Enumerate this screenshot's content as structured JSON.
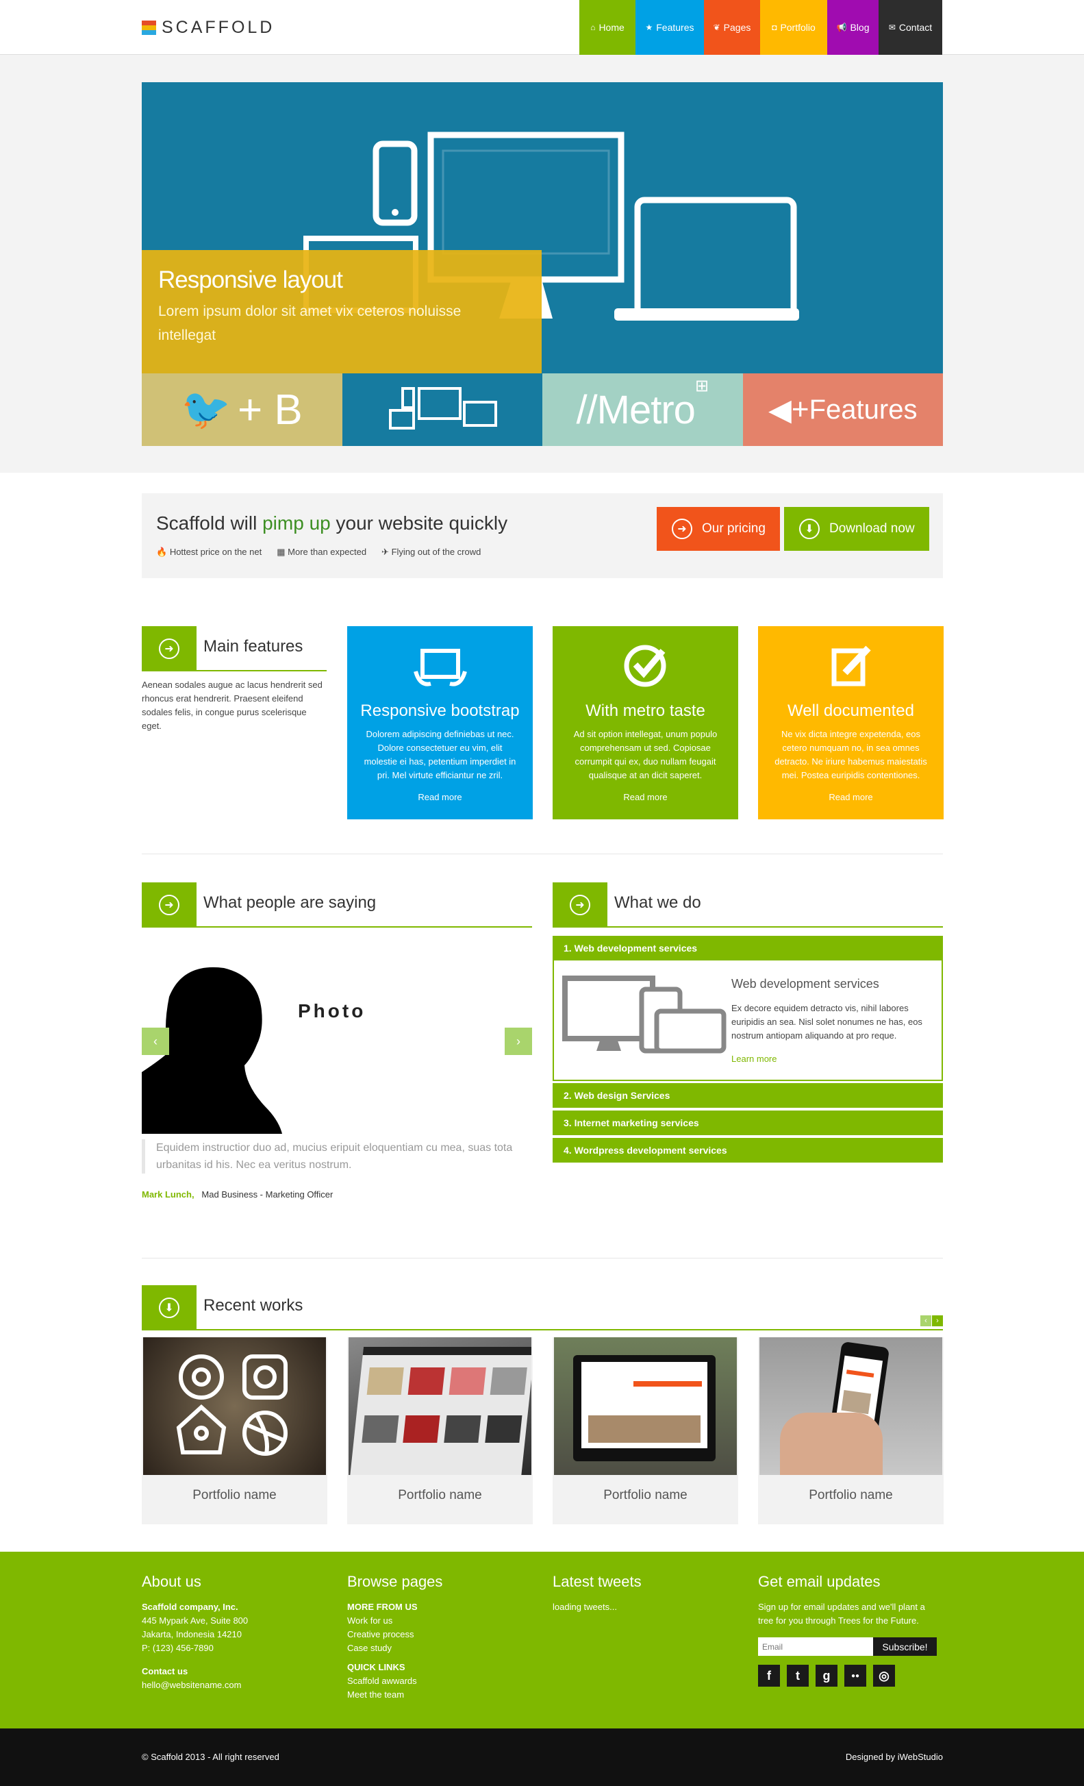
{
  "brand": {
    "name": "SCAFFOLD",
    "logo_colors": [
      "#e54d26",
      "#f2b705",
      "#29a8e0"
    ]
  },
  "nav": [
    {
      "label": "Home",
      "icon": "home-icon",
      "glyph": "⌂",
      "color": "#7fb800"
    },
    {
      "label": "Features",
      "icon": "star-icon",
      "glyph": "★",
      "color": "#00a1e5"
    },
    {
      "label": "Pages",
      "icon": "leaf-icon",
      "glyph": "❦",
      "color": "#f1541b"
    },
    {
      "label": "Portfolio",
      "icon": "camera-icon",
      "glyph": "◘",
      "color": "#ffb900"
    },
    {
      "label": "Blog",
      "icon": "megaphone-icon",
      "glyph": "📢",
      "color": "#a00cb0"
    },
    {
      "label": "Contact",
      "icon": "envelope-icon",
      "glyph": "✉",
      "color": "#2d2d2d"
    }
  ],
  "hero": {
    "title": "Responsive layout",
    "text": "Lorem ipsum dolor sit amet vix ceteros noluisse intellegat"
  },
  "tiles": [
    {
      "label": "+ B",
      "color": "#d0c176"
    },
    {
      "label": "",
      "color": "#167ba0"
    },
    {
      "label": "//Metro",
      "color": "#a3d1c4"
    },
    {
      "label": "Features",
      "color": "#e4826a"
    }
  ],
  "promo": {
    "title_pre": "Scaffold will ",
    "title_hl": "pimp up",
    "title_post": " your website quickly",
    "points": [
      "Hottest price on the net",
      "More than expected",
      "Flying out of the crowd"
    ],
    "pricing_label": "Our pricing",
    "download_label": "Download now"
  },
  "main_features": {
    "title": "Main features",
    "text": "Aenean sodales augue ac lacus hendrerit sed rhoncus erat hendrerit. Praesent eleifend sodales felis, in congue purus scelerisque eget."
  },
  "features": [
    {
      "title": "Responsive bootstrap",
      "text": "Dolorem adipiscing definiebas ut nec. Dolore consectetuer eu vim, elit molestie ei has, petentium imperdiet in pri. Mel virtute efficiantur ne zril.",
      "more": "Read more",
      "color": "#00a1e5"
    },
    {
      "title": "With metro taste",
      "text": "Ad sit option intellegat, unum populo comprehensam ut sed. Copiosae corrumpit qui ex, duo nullam feugait qualisque at an dicit saperet.",
      "more": "Read more",
      "color": "#7fb800"
    },
    {
      "title": "Well documented",
      "text": "Ne vix dicta integre expetenda, eos cetero numquam no, in sea omnes detracto. Ne iriure habemus maiestatis mei. Postea euripidis contentiones.",
      "more": "Read more",
      "color": "#ffb900"
    }
  ],
  "testimonials": {
    "title": "What people are saying",
    "photo_label": "Photo",
    "quote": "Equidem instructior duo ad, mucius eripuit eloquentiam cu mea, suas tota urbanitas id his. Nec ea veritus nostrum.",
    "author": "Mark Lunch,",
    "role": "Mad Business - Marketing Officer"
  },
  "what_we_do": {
    "title": "What we do",
    "items": [
      "1. Web development services",
      "2. Web design Services",
      "3. Internet marketing services",
      "4. Wordpress development services"
    ],
    "open": {
      "title": "Web development services",
      "text": "Ex decore equidem detracto vis, nihil labores euripidis an sea. Nisl solet nonumes ne has, eos nostrum antiopam aliquando at pro reque.",
      "more": "Learn more"
    }
  },
  "recent": {
    "title": "Recent works",
    "items": [
      "Portfolio name",
      "Portfolio name",
      "Portfolio name",
      "Portfolio name"
    ]
  },
  "footer": {
    "about": {
      "title": "About us",
      "company": "Scaffold company, Inc.",
      "address1": "445 Mypark Ave, Suite 800",
      "address2": "Jakarta, Indonesia 14210",
      "phone": "P: (123) 456-7890",
      "contact_title": "Contact us",
      "email": "hello@websitename.com"
    },
    "browse": {
      "title": "Browse pages",
      "group1": "MORE FROM US",
      "links1": [
        "Work for us",
        "Creative process",
        "Case study"
      ],
      "group2": "QUICK LINKS",
      "links2": [
        "Scaffold awwards",
        "Meet the team"
      ]
    },
    "tweets": {
      "title": "Latest tweets",
      "text": "loading tweets..."
    },
    "email": {
      "title": "Get email updates",
      "text": "Sign up for email updates and we'll plant a tree for you through Trees for the Future.",
      "placeholder": "Email",
      "button": "Subscribe!"
    },
    "social": [
      {
        "glyph": "f",
        "icon": "facebook-icon"
      },
      {
        "glyph": "t",
        "icon": "twitter-icon"
      },
      {
        "glyph": "g",
        "icon": "google-icon"
      },
      {
        "glyph": "●●",
        "icon": "flickr-icon"
      },
      {
        "glyph": "◎",
        "icon": "dribbble-icon"
      }
    ],
    "copyright": "© Scaffold 2013 - All right reserved",
    "designed": "Designed by iWebStudio"
  }
}
